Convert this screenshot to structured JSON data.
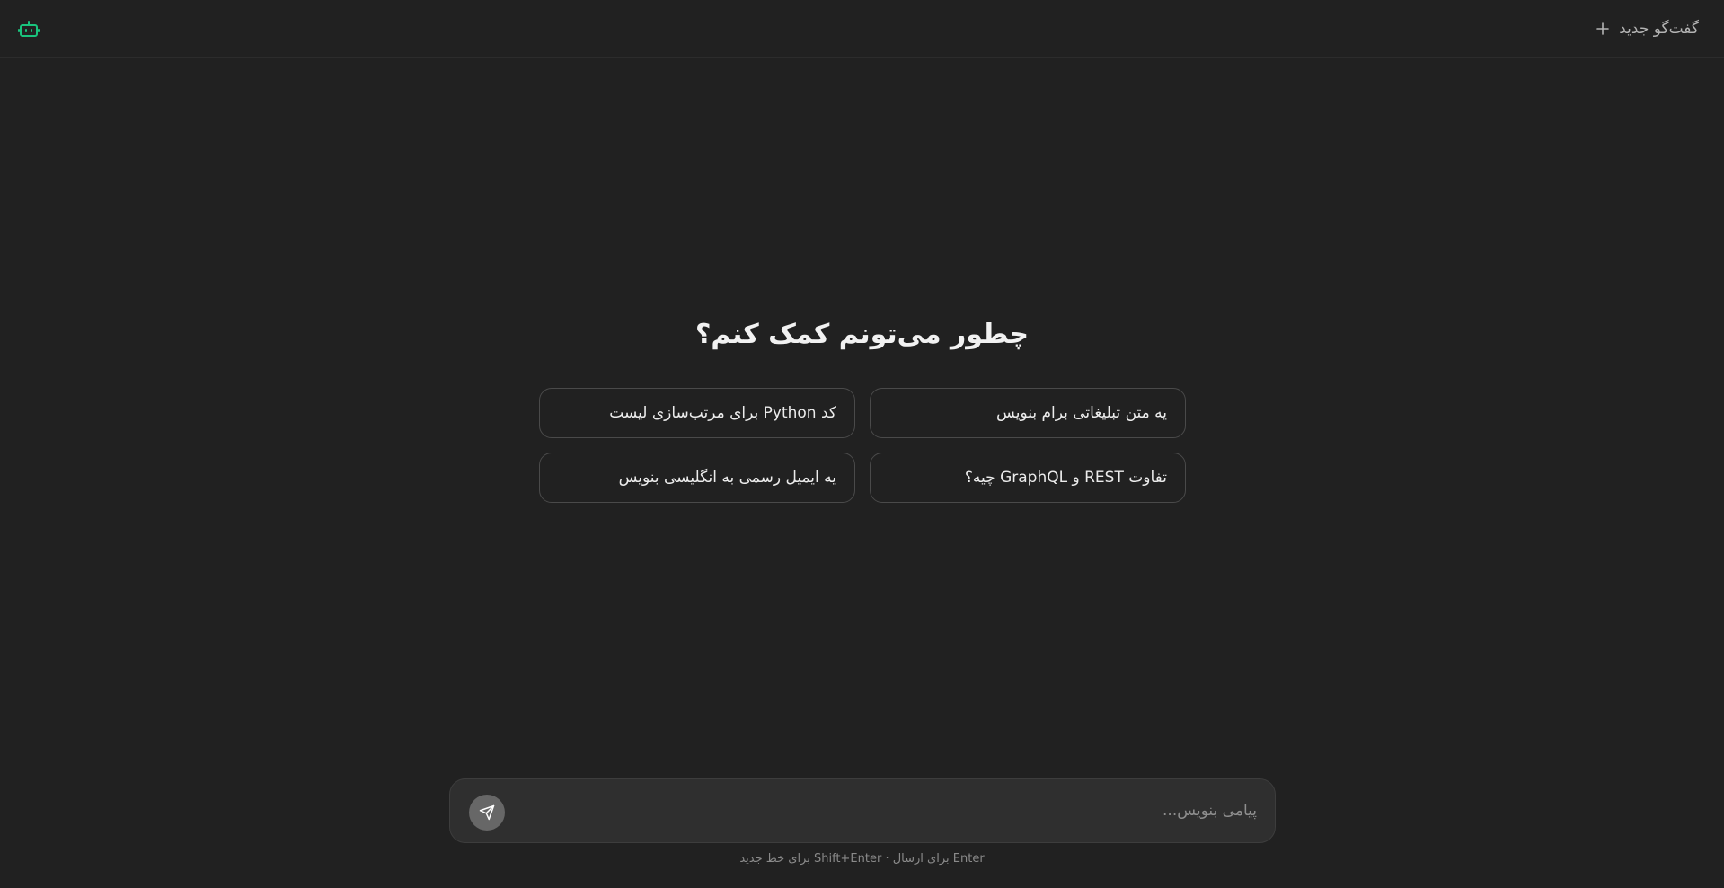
{
  "header": {
    "logo_icon": "robot-icon",
    "new_chat_label": "گفت‌گو جدید",
    "new_chat_icon": "plus-icon"
  },
  "main": {
    "heading": "چطور می‌تونم کمک کنم؟",
    "suggestions": [
      "یه متن تبلیغاتی برام بنویس",
      "کد Python برای مرتب‌سازی لیست",
      "تفاوت REST و GraphQL چیه؟",
      "یه ایمیل رسمی به انگلیسی بنویس"
    ]
  },
  "composer": {
    "placeholder": "پیامی بنویس...",
    "send_icon": "send-icon",
    "hint": "Enter برای ارسال · Shift+Enter برای خط جدید"
  },
  "colors": {
    "background": "#212121",
    "accent": "#19c37d",
    "composer_bg": "#2f2f2f"
  }
}
